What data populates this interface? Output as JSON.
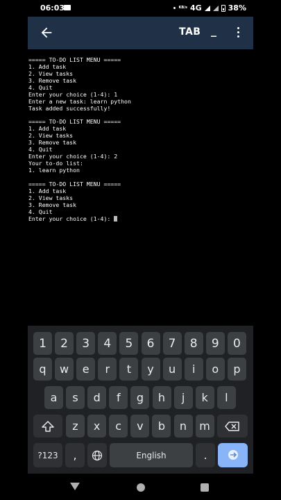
{
  "status_bar": {
    "time": "06:03",
    "network": "4G",
    "battery": "38%",
    "data_label": "KB/s"
  },
  "appbar": {
    "tab_label": "TAB",
    "underscore_label": "_"
  },
  "terminal": {
    "lines": [
      "===== TO-DO LIST MENU =====",
      "1. Add task",
      "2. View tasks",
      "3. Remove task",
      "4. Quit",
      "Enter your choice (1-4): 1",
      "Enter a new task: learn python",
      "Task added successfully!",
      "",
      "===== TO-DO LIST MENU =====",
      "1. Add task",
      "2. View tasks",
      "3. Remove task",
      "4. Quit",
      "Enter your choice (1-4): 2",
      "Your to-do list:",
      "1. learn python",
      "",
      "===== TO-DO LIST MENU =====",
      "1. Add task",
      "2. View tasks",
      "3. Remove task",
      "4. Quit",
      "Enter your choice (1-4): "
    ]
  },
  "keyboard": {
    "numbers": [
      "1",
      "2",
      "3",
      "4",
      "5",
      "6",
      "7",
      "8",
      "9",
      "0"
    ],
    "row1": [
      "q",
      "w",
      "e",
      "r",
      "t",
      "y",
      "u",
      "i",
      "o",
      "p"
    ],
    "row2": [
      "a",
      "s",
      "d",
      "f",
      "g",
      "h",
      "j",
      "k",
      "l"
    ],
    "row3": [
      "z",
      "x",
      "c",
      "v",
      "b",
      "n",
      "m"
    ],
    "symbols_label": "?123",
    "comma_label": ",",
    "space_label": "English",
    "period_label": ".",
    "shift_icon": "shift-arrow-icon",
    "delete_icon": "backspace-icon",
    "language_icon": "globe-icon",
    "enter_icon": "enter-icon"
  },
  "colors": {
    "appbar": "#1f3047",
    "keyboard_bg": "#202124",
    "key": "#3c4043",
    "enter": "#8ab4f8"
  }
}
